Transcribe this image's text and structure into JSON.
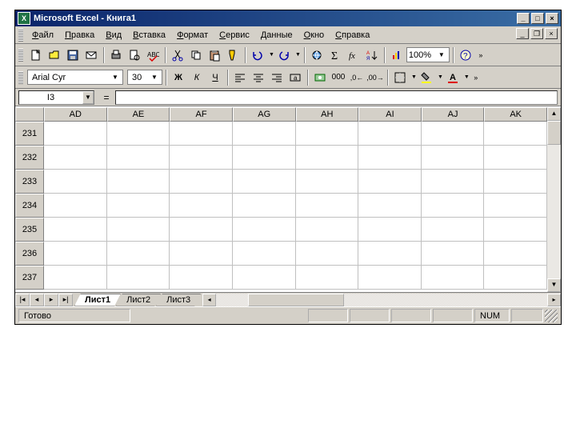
{
  "title": "Microsoft Excel - Книга1",
  "menu": [
    "Файл",
    "Правка",
    "Вид",
    "Вставка",
    "Формат",
    "Сервис",
    "Данные",
    "Окно",
    "Справка"
  ],
  "zoom": "100%",
  "font": {
    "name": "Arial Cyr",
    "size": "30"
  },
  "format_buttons": {
    "bold": "Ж",
    "italic": "К",
    "underline": "Ч"
  },
  "name_box": "I3",
  "formula_eq": "=",
  "columns": [
    "AD",
    "AE",
    "AF",
    "AG",
    "AH",
    "AI",
    "AJ",
    "AK"
  ],
  "rows": [
    "231",
    "232",
    "233",
    "234",
    "235",
    "236",
    "237"
  ],
  "sheets": [
    "Лист1",
    "Лист2",
    "Лист3"
  ],
  "active_sheet": 0,
  "status": "Готово",
  "indicator": "NUM"
}
